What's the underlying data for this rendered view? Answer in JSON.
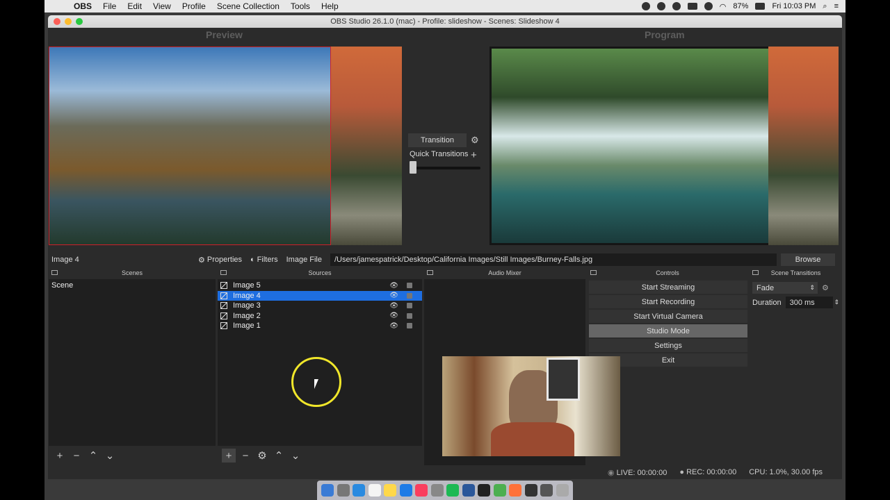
{
  "menubar": {
    "app": "OBS",
    "items": [
      "File",
      "Edit",
      "View",
      "Profile",
      "Scene Collection",
      "Tools",
      "Help"
    ],
    "battery": "87%",
    "clock": "Fri 10:03 PM"
  },
  "window": {
    "title": "OBS Studio 26.1.0 (mac) - Profile: slideshow - Scenes: Slideshow 4"
  },
  "studio": {
    "preview_label": "Preview",
    "program_label": "Program",
    "transition_label": "Transition",
    "quick_transitions_label": "Quick Transitions"
  },
  "source_toolbar": {
    "current_source": "Image 4",
    "properties_label": "Properties",
    "filters_label": "Filters",
    "image_file_label": "Image File",
    "path": "/Users/jamespatrick/Desktop/California Images/Still Images/Burney-Falls.jpg",
    "browse_label": "Browse"
  },
  "docks": {
    "scenes": {
      "title": "Scenes",
      "items": [
        "Scene"
      ]
    },
    "sources": {
      "title": "Sources",
      "items": [
        {
          "name": "Image 5",
          "selected": false
        },
        {
          "name": "Image 4",
          "selected": true
        },
        {
          "name": "Image 3",
          "selected": false
        },
        {
          "name": "Image 2",
          "selected": false
        },
        {
          "name": "Image 1",
          "selected": false
        }
      ]
    },
    "audio_mixer": {
      "title": "Audio Mixer"
    },
    "controls": {
      "title": "Controls",
      "buttons": [
        "Start Streaming",
        "Start Recording",
        "Start Virtual Camera",
        "Studio Mode",
        "Settings",
        "Exit"
      ],
      "active": "Studio Mode"
    },
    "scene_transitions": {
      "title": "Scene Transitions",
      "selected": "Fade",
      "duration_label": "Duration",
      "duration_value": "300 ms"
    }
  },
  "statusbar": {
    "live": "LIVE: 00:00:00",
    "rec": "REC: 00:00:00",
    "cpu": "CPU: 1.0%, 30.00 fps"
  },
  "colors": {
    "selection": "#1e6ee0",
    "cursor_highlight": "#f0e62a",
    "preview_border": "#d0202a"
  }
}
